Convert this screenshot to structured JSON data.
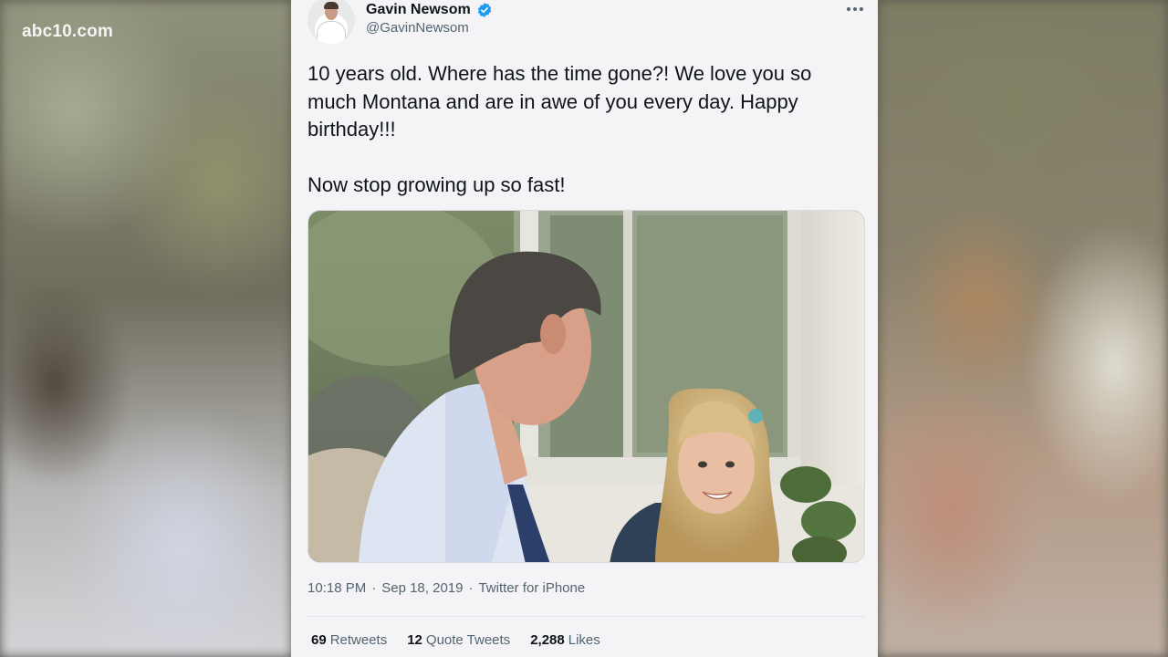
{
  "station": {
    "logo": "abc10.com"
  },
  "tweet": {
    "author": {
      "display_name": "Gavin Newsom",
      "handle": "@GavinNewsom",
      "verified": true
    },
    "text_paragraphs": [
      "10 years old. Where has the time gone?! We love you so much Montana and are in awe of you every day. Happy birthday!!!",
      "Now stop growing up so fast!"
    ],
    "meta": {
      "time": "10:18 PM",
      "separator": "·",
      "date": "Sep 18, 2019",
      "source": "Twitter for iPhone"
    },
    "stats": {
      "retweets_count": "69",
      "retweets_label": "Retweets",
      "quotes_count": "12",
      "quotes_label": "Quote Tweets",
      "likes_count": "2,288",
      "likes_label": "Likes"
    }
  },
  "colors": {
    "verified_blue": "#1d9bf0",
    "secondary_text": "#536471",
    "primary_text": "#0f1419"
  },
  "icons": {
    "verified": "verified-badge-icon",
    "more": "more-options-icon"
  }
}
